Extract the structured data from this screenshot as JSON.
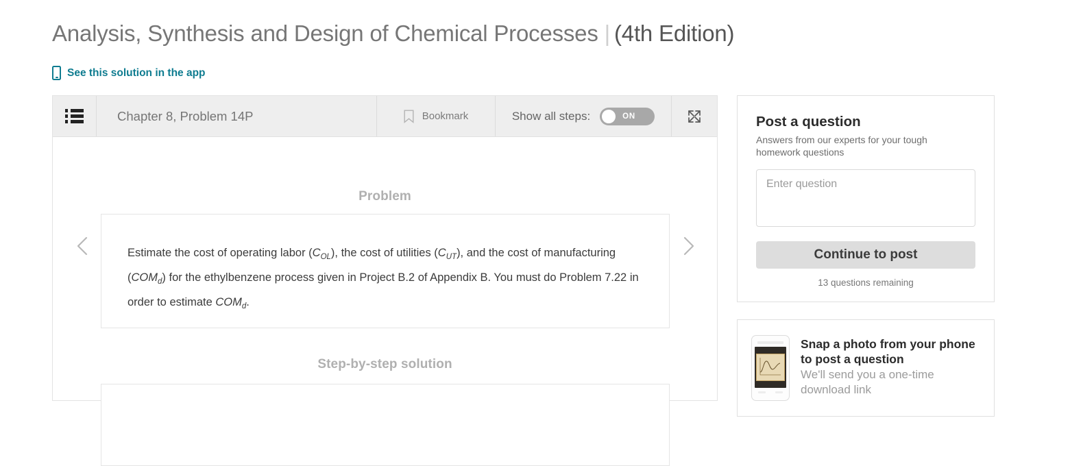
{
  "header": {
    "book_title": "Analysis, Synthesis and Design of Chemical Processes",
    "separator": "|",
    "edition": "(4th Edition)",
    "app_link": "See this solution in the app"
  },
  "toolbar": {
    "list_icon": "list-icon",
    "chapter": "Chapter 8, Problem 14P",
    "bookmark_icon": "bookmark-icon",
    "bookmark_label": "Bookmark",
    "show_all_steps_label": "Show all steps:",
    "toggle_state": "ON",
    "expand_icon": "expand-icon"
  },
  "main": {
    "problem_heading": "Problem",
    "problem_text_p1": "Estimate the cost of operating labor (",
    "var_col": "C",
    "sub_ol": "OL",
    "problem_text_p2": "), the cost of utilities (",
    "var_cut": "C",
    "sub_ut": "UT",
    "problem_text_p3": "), and the cost of manufacturing (",
    "var_com1": "COM",
    "sub_d1": "d",
    "problem_text_p4": ") for the ethylbenzene process given in Project B.2 of Appendix B. You must do Problem 7.22 in order to estimate ",
    "var_com2": "COM",
    "sub_d2": "d",
    "problem_text_p5": ".",
    "solution_heading": "Step-by-step solution",
    "prev_arrow_icon": "chevron-left-icon",
    "next_arrow_icon": "chevron-right-icon"
  },
  "rail": {
    "ask": {
      "title": "Post a question",
      "subtitle": "Answers from our experts for your tough homework questions",
      "input_placeholder": "Enter question",
      "input_value": "",
      "button_label": "Continue to post",
      "note": "13 questions remaining"
    },
    "snap": {
      "thumb_icon": "phone-thumbnail-icon",
      "title": "Snap a photo from your phone to post a question",
      "subtitle": "We'll send you a one-time download link"
    }
  },
  "colors": {
    "accent_teal": "#0f7c90",
    "title_gray": "#767676",
    "toolbar_bg": "#eeeeee",
    "toggle_track": "#a8a8a8",
    "button_bg": "#dddddd"
  }
}
